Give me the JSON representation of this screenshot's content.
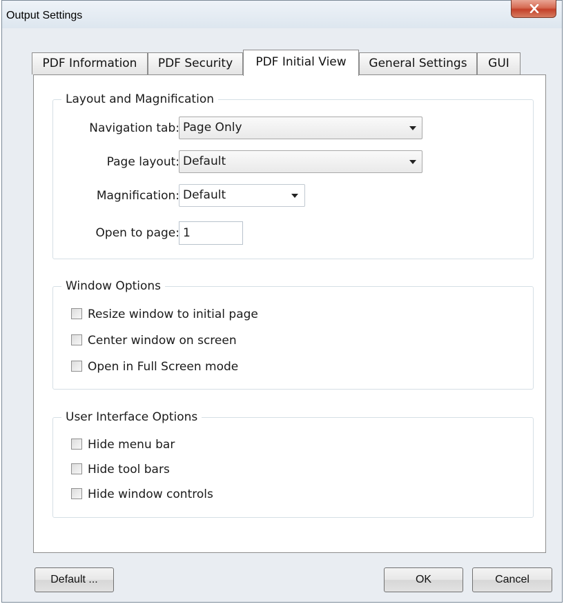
{
  "window": {
    "title": "Output Settings"
  },
  "tabs": [
    {
      "label": "PDF Information",
      "active": false
    },
    {
      "label": "PDF Security",
      "active": false
    },
    {
      "label": "PDF Initial View",
      "active": true
    },
    {
      "label": "General Settings",
      "active": false
    },
    {
      "label": "GUI",
      "active": false
    }
  ],
  "layout_group": {
    "title": "Layout and Magnification",
    "navigation_tab": {
      "label": "Navigation tab:",
      "value": "Page Only"
    },
    "page_layout": {
      "label": "Page layout:",
      "value": "Default"
    },
    "magnification": {
      "label": "Magnification:",
      "value": "Default"
    },
    "open_to_page": {
      "label": "Open to page:",
      "value": "1"
    }
  },
  "window_options": {
    "title": "Window Options",
    "items": [
      {
        "label": "Resize window to initial page",
        "checked": false
      },
      {
        "label": "Center window on screen",
        "checked": false
      },
      {
        "label": "Open in Full Screen mode",
        "checked": false
      }
    ]
  },
  "ui_options": {
    "title": "User Interface Options",
    "items": [
      {
        "label": "Hide menu bar",
        "checked": false
      },
      {
        "label": "Hide tool bars",
        "checked": false
      },
      {
        "label": "Hide window controls",
        "checked": false
      }
    ]
  },
  "buttons": {
    "default": "Default ...",
    "ok": "OK",
    "cancel": "Cancel"
  },
  "icons": {
    "close": "close-icon",
    "dropdown": "chevron-down-icon"
  },
  "colors": {
    "close_button": "#c4412a",
    "panel": "#ffffff",
    "chrome": "#e9edf2"
  }
}
